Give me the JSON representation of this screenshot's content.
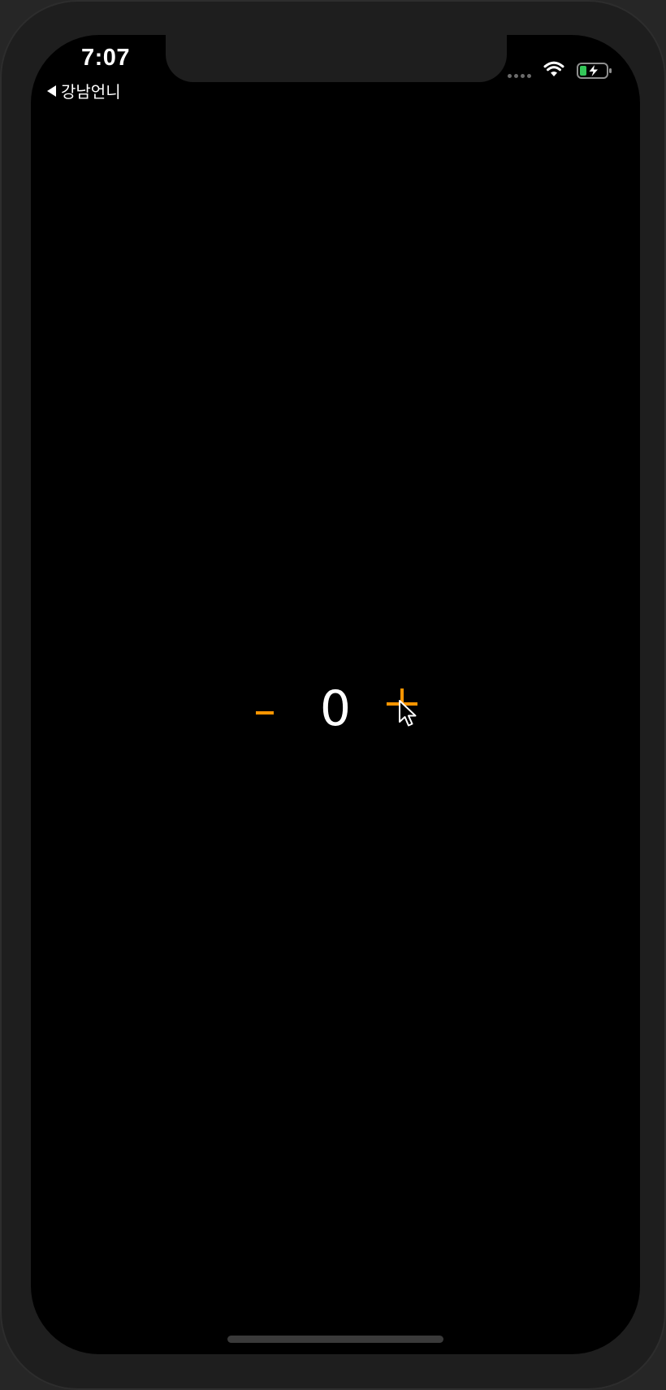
{
  "status_bar": {
    "time": "7:07",
    "back_label": "강남언니"
  },
  "icons": {
    "back": "back-arrow-icon",
    "signal": "cellular-signal-icon",
    "wifi": "wifi-icon",
    "battery": "battery-charging-icon",
    "cursor": "mouse-pointer-icon"
  },
  "counter": {
    "decrement_label": "-",
    "value": "0",
    "increment_label": "+"
  },
  "colors": {
    "accent": "#ff9500",
    "background": "#000000",
    "text": "#ffffff",
    "battery_level": "#34c759"
  }
}
